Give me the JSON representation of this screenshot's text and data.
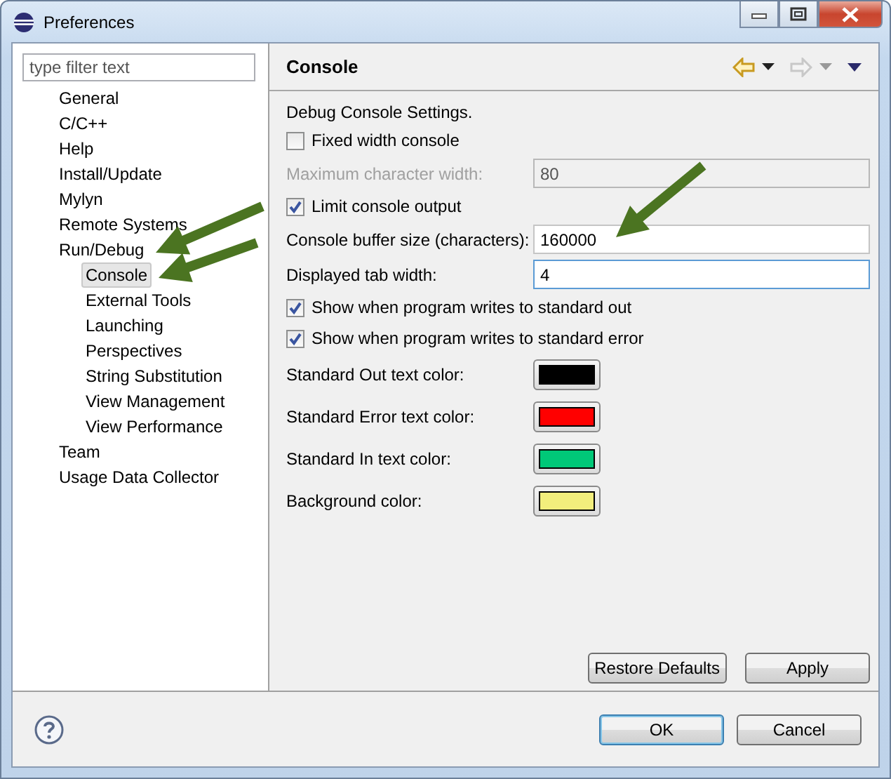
{
  "window": {
    "title": "Preferences"
  },
  "filter": {
    "placeholder": "type filter text"
  },
  "tree": [
    {
      "label": "General",
      "selected": false
    },
    {
      "label": "C/C++",
      "selected": false
    },
    {
      "label": "Help",
      "selected": false
    },
    {
      "label": "Install/Update",
      "selected": false
    },
    {
      "label": "Mylyn",
      "selected": false
    },
    {
      "label": "Remote Systems",
      "selected": false
    },
    {
      "label": "Run/Debug",
      "selected": false,
      "children": [
        {
          "label": "Console",
          "selected": true
        },
        {
          "label": "External Tools",
          "selected": false
        },
        {
          "label": "Launching",
          "selected": false
        },
        {
          "label": "Perspectives",
          "selected": false
        },
        {
          "label": "String Substitution",
          "selected": false
        },
        {
          "label": "View Management",
          "selected": false
        },
        {
          "label": "View Performance",
          "selected": false
        }
      ]
    },
    {
      "label": "Team",
      "selected": false
    },
    {
      "label": "Usage Data Collector",
      "selected": false
    }
  ],
  "page": {
    "title": "Console",
    "description": "Debug Console Settings.",
    "settings": [
      {
        "kind": "checkbox",
        "label": "Fixed width console",
        "checked": false
      },
      {
        "kind": "field",
        "label": "Maximum character width:",
        "value": "80",
        "disabled": true,
        "focused": false
      },
      {
        "kind": "checkbox",
        "label": "Limit console output",
        "checked": true
      },
      {
        "kind": "field",
        "label": "Console buffer size (characters):",
        "value": "160000",
        "disabled": false,
        "focused": false
      },
      {
        "kind": "field",
        "label": "Displayed tab width:",
        "value": "4",
        "disabled": false,
        "focused": true
      },
      {
        "kind": "checkbox",
        "label": "Show when program writes to standard out",
        "checked": true
      },
      {
        "kind": "checkbox",
        "label": "Show when program writes to standard error",
        "checked": true
      },
      {
        "kind": "color",
        "label": "Standard Out text color:",
        "color": "#000000"
      },
      {
        "kind": "color",
        "label": "Standard Error text color:",
        "color": "#ff0000"
      },
      {
        "kind": "color",
        "label": "Standard In text color:",
        "color": "#00c878"
      },
      {
        "kind": "color",
        "label": "Background color:",
        "color": "#f2ee7c"
      }
    ],
    "buttons": [
      "Restore Defaults",
      "Apply"
    ]
  },
  "dialog_buttons": [
    {
      "label": "OK",
      "default": true
    },
    {
      "label": "Cancel",
      "default": false
    }
  ]
}
